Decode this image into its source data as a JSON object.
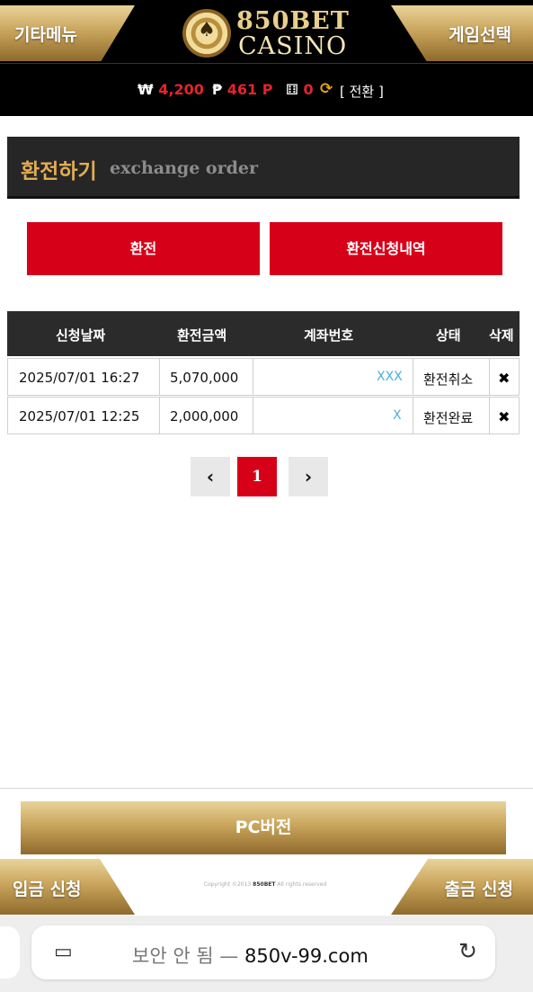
{
  "header": {
    "left_menu": "기타메뉴",
    "right_menu": "게임선택",
    "logo_line1": "850BET",
    "logo_line2": "CASINO",
    "logo_icon": "spade-chip-icon"
  },
  "balance": {
    "cash_symbol": "₩",
    "cash_value": "4,200",
    "point_symbol": "₱",
    "point_value": "461 P",
    "dice_icon": "dice-icon",
    "dice_value": "0",
    "refresh_icon": "refresh-icon",
    "convert_label": "[ 전환 ]"
  },
  "page": {
    "title_kr": "환전하기",
    "title_en": "exchange order"
  },
  "buttons": {
    "exchange": "환전",
    "history": "환전신청내역"
  },
  "table": {
    "headers": [
      "신청날짜",
      "환전금액",
      "계좌번호",
      "상태",
      "삭제"
    ],
    "rows": [
      {
        "date": "2025/07/01 16:27",
        "amount": "5,070,000",
        "account": "XXX",
        "status": "환전취소",
        "delete": "✖"
      },
      {
        "date": "2025/07/01 12:25",
        "amount": "2,000,000",
        "account": "X",
        "status": "환전완료",
        "delete": "✖"
      }
    ]
  },
  "pagination": {
    "prev": "‹",
    "current": "1",
    "next": "›"
  },
  "footer": {
    "pc_button": "PC버전",
    "deposit": "입금 신청",
    "withdraw": "출금 신청",
    "copyright_prefix": "Copyright ©2013",
    "copyright_brand": "850BET",
    "copyright_suffix": "All rights reserved"
  },
  "browser": {
    "insecure_label": "보안 안 됨 —",
    "domain": "850v-99.com",
    "reader_icon": "reader-icon",
    "reload_icon": "reload-icon"
  },
  "colors": {
    "accent_red": "#d70019",
    "gold": "#c9a55c",
    "title_gold": "#e3ad52",
    "dark": "#262626"
  }
}
